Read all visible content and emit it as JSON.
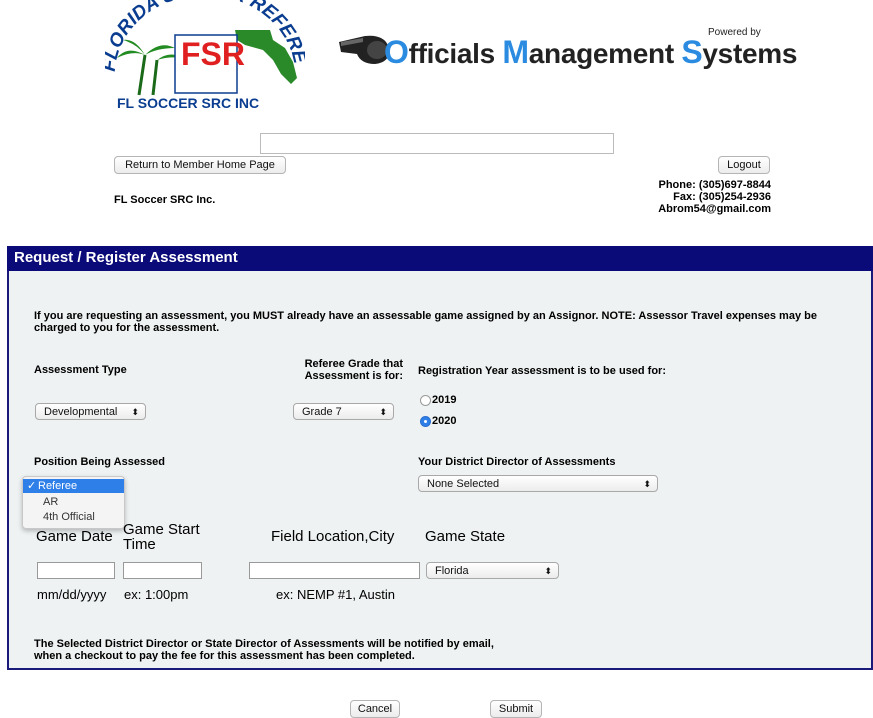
{
  "header": {
    "logo": {
      "arc_text": "FLORIDA SOCCER REFEREES",
      "letters": "FSR",
      "subtext": "FL SOCCER SRC INC"
    },
    "powered_by": "Powered by",
    "oms": {
      "o": "O",
      "fficials": "fficials ",
      "m": "M",
      "anagement": "anagement ",
      "s": "S",
      "ystems": "ystems"
    },
    "search_value": "",
    "return_button": "Return to Member Home Page",
    "logout_button": "Logout",
    "org_name": "FL Soccer SRC Inc.",
    "phone": "Phone: (305)697-8844",
    "fax": "Fax: (305)254-2936",
    "email": "Abrom54@gmail.com"
  },
  "panel": {
    "title": "Request / Register Assessment",
    "intro": "If you are requesting an assessment, you MUST already have an assessable game assigned by an Assignor.  NOTE: Assessor Travel expenses may be charged to you for the assessment.",
    "assessment_type_label": "Assessment Type",
    "assessment_type_value": "Developmental",
    "grade_label": "Referee Grade that Assessment is for:",
    "grade_value": "Grade 7",
    "reg_year_label": "Registration Year assessment is to be used for:",
    "years": [
      {
        "label": "2019",
        "selected": false
      },
      {
        "label": "2020",
        "selected": true
      }
    ],
    "position_label": "Position Being Assessed",
    "position_options": [
      {
        "label": "Referee",
        "selected": true
      },
      {
        "label": "AR",
        "selected": false
      },
      {
        "label": "4th Official",
        "selected": false
      }
    ],
    "district_label": "Your District Director of Assessments",
    "district_value": "None Selected",
    "game_date_label": "Game Date",
    "game_start_label": "Game Start Time",
    "field_location_label": "Field Location,City",
    "game_state_label": "Game State",
    "game_state_value": "Florida",
    "game_date_value": "",
    "game_start_value": "",
    "field_location_value": "",
    "date_hint": "mm/dd/yyyy",
    "time_hint": "ex: 1:00pm",
    "location_hint": "ex: NEMP #1, Austin",
    "notice": "The Selected District Director or State Director of Assessments will be notified by email, when a checkout to pay the fee for this assessment has been completed."
  },
  "footer": {
    "cancel_button": "Cancel",
    "submit_button": "Submit"
  },
  "colors": {
    "panel_header": "#0a0a78",
    "panel_border": "#1a1a7a",
    "panel_bg": "#eef2f2",
    "oms_blue": "#2a8be0",
    "select_blue": "#2f7fe8"
  }
}
